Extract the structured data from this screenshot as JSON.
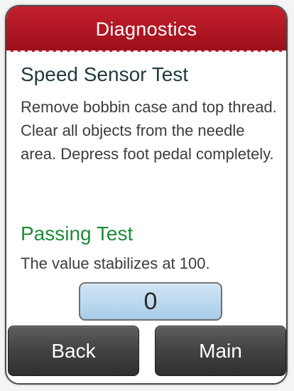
{
  "header": {
    "title": "Diagnostics"
  },
  "test": {
    "title": "Speed Sensor Test",
    "instructions": "Remove bobbin case and top thread.  Clear all objects from the needle area.  Depress foot pedal completely."
  },
  "passing": {
    "title": "Passing Test",
    "description": "The value stabilizes at 100."
  },
  "reading": {
    "value": "0"
  },
  "buttons": {
    "back": "Back",
    "main": "Main"
  },
  "colors": {
    "header": "#b01824",
    "passing_text": "#1f8a3a",
    "title_text": "#1f3a3f",
    "value_box": "#bcdaf0",
    "button": "#444444"
  }
}
